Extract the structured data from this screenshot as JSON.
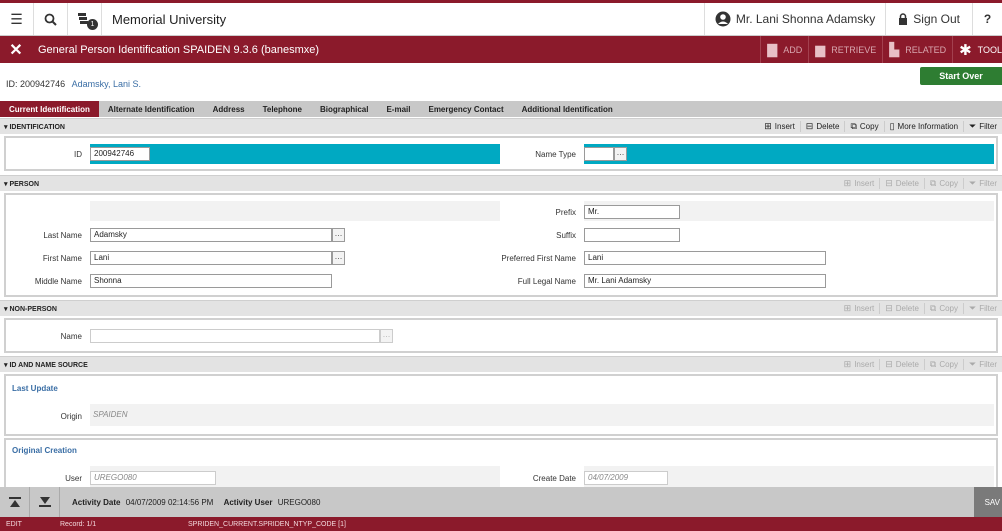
{
  "topbar": {
    "menu_icon": "hamburger-icon",
    "search_icon": "search-icon",
    "recent_icon": "recent-items-icon",
    "recent_count": "1",
    "title": "Memorial University",
    "user_name": "Mr. Lani Shonna Adamsky",
    "sign_out": "Sign Out",
    "help": "?"
  },
  "pagebar": {
    "close": "✕",
    "title": "General Person Identification SPAIDEN 9.3.6 (banesmxe)",
    "tools": [
      {
        "label": "ADD",
        "icon": "add-page-icon"
      },
      {
        "label": "RETRIEVE",
        "icon": "retrieve-icon"
      },
      {
        "label": "RELATED",
        "icon": "related-icon"
      },
      {
        "label": "TOOL",
        "icon": "gear-icon"
      }
    ]
  },
  "keyblock": {
    "id_label": "ID:",
    "id_value": "200942746",
    "name": "Adamsky, Lani S.",
    "start_over": "Start Over"
  },
  "tabs": [
    "Current Identification",
    "Alternate Identification",
    "Address",
    "Telephone",
    "Biographical",
    "E-mail",
    "Emergency Contact",
    "Additional Identification"
  ],
  "section_tools": {
    "insert": "Insert",
    "delete": "Delete",
    "copy": "Copy",
    "more": "More Information",
    "filter": "Filter"
  },
  "identification": {
    "title": "IDENTIFICATION",
    "id_label": "ID",
    "id_value": "200942746",
    "name_type_label": "Name Type",
    "name_type_value": ""
  },
  "person": {
    "title": "PERSON",
    "last_name_label": "Last Name",
    "last_name": "Adamsky",
    "first_name_label": "First Name",
    "first_name": "Lani",
    "middle_name_label": "Middle Name",
    "middle_name": "Shonna",
    "prefix_label": "Prefix",
    "prefix": "Mr.",
    "suffix_label": "Suffix",
    "suffix": "",
    "preferred_label": "Preferred First Name",
    "preferred": "Lani",
    "legal_label": "Full Legal Name",
    "legal": "Mr. Lani Adamsky"
  },
  "nonperson": {
    "title": "NON-PERSON",
    "name_label": "Name",
    "name": ""
  },
  "source": {
    "title": "ID AND NAME SOURCE",
    "last_update": "Last Update",
    "origin_label": "Origin",
    "origin": "SPAIDEN",
    "original_creation": "Original Creation",
    "user_label": "User",
    "user": "UREGO080",
    "create_date_label": "Create Date",
    "create_date": "04/07/2009"
  },
  "activity": {
    "date_label": "Activity Date",
    "date": "04/07/2009 02:14:56 PM",
    "user_label": "Activity User",
    "user": "UREGO080",
    "save": "SAV"
  },
  "status": {
    "mode": "EDIT",
    "record": "Record: 1/1",
    "field": "SPRIDEN_CURRENT.SPRIDEN_NTYP_CODE [1]"
  },
  "colors": {
    "brand": "#8b1a2b",
    "accent_teal": "#00a9c2",
    "start_over": "#2e7d32"
  }
}
